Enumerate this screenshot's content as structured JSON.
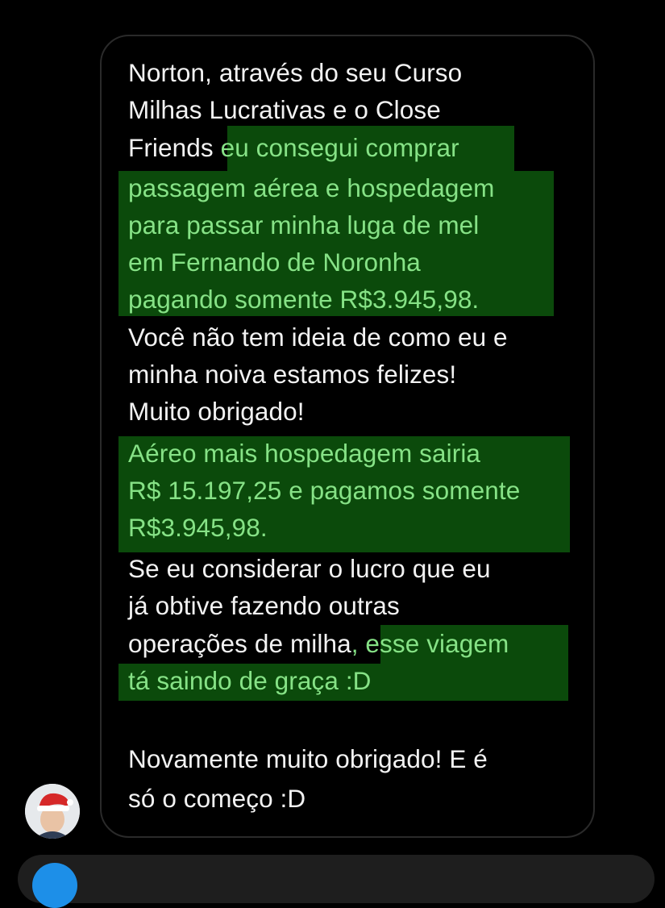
{
  "conversation": {
    "message_lines": [
      {
        "segments": [
          {
            "text": "Norton, através do seu Curso",
            "hl": false
          }
        ]
      },
      {
        "segments": [
          {
            "text": "Milhas Lucrativas e o Close",
            "hl": false
          }
        ]
      },
      {
        "segments": [
          {
            "text": "Friends ",
            "hl": false
          },
          {
            "text": "eu consegui comprar",
            "hl": true
          }
        ]
      },
      {
        "segments": [
          {
            "text": "passagem aérea e hospedagem",
            "hl": true
          }
        ]
      },
      {
        "segments": [
          {
            "text": "para passar minha luga de mel",
            "hl": true
          }
        ]
      },
      {
        "segments": [
          {
            "text": "em Fernando de Noronha",
            "hl": true
          }
        ]
      },
      {
        "segments": [
          {
            "text": "pagando somente R$3.945,98.",
            "hl": true
          }
        ]
      },
      {
        "segments": [
          {
            "text": "Você não tem ideia de como eu e",
            "hl": false
          }
        ]
      },
      {
        "segments": [
          {
            "text": "minha noiva estamos felizes!",
            "hl": false
          }
        ]
      },
      {
        "segments": [
          {
            "text": "Muito obrigado!",
            "hl": false
          }
        ]
      },
      {
        "segments": [
          {
            "text": "Aéreo mais hospedagem sairia",
            "hl": true
          }
        ]
      },
      {
        "segments": [
          {
            "text": "R$ 15.197,25 e pagamos somente",
            "hl": true
          }
        ]
      },
      {
        "segments": [
          {
            "text": "R$3.945,98.",
            "hl": true
          }
        ]
      },
      {
        "segments": [
          {
            "text": "Se eu considerar o lucro que eu",
            "hl": false
          }
        ]
      },
      {
        "segments": [
          {
            "text": "já obtive fazendo outras",
            "hl": false
          }
        ]
      },
      {
        "segments": [
          {
            "text": "operações de milha",
            "hl": false
          },
          {
            "text": ", esse viagem",
            "hl": true
          }
        ]
      },
      {
        "segments": [
          {
            "text": "tá saindo de graça :D",
            "hl": true
          }
        ]
      },
      {
        "segments": [
          {
            "text": "Novamente muito obrigado! E é",
            "hl": false
          }
        ]
      },
      {
        "segments": [
          {
            "text": "só o começo :D",
            "hl": false
          }
        ]
      }
    ]
  },
  "colors": {
    "background": "#000000",
    "bubble_border": "#2a2a2a",
    "text": "#f2f2f2",
    "highlight_bg": "#0b4a0b",
    "highlight_text": "#86e286",
    "composer_accent": "#1d8fe8"
  },
  "icons": {
    "avatar": "user-avatar-santa-hat",
    "composer_button": "camera-icon"
  }
}
